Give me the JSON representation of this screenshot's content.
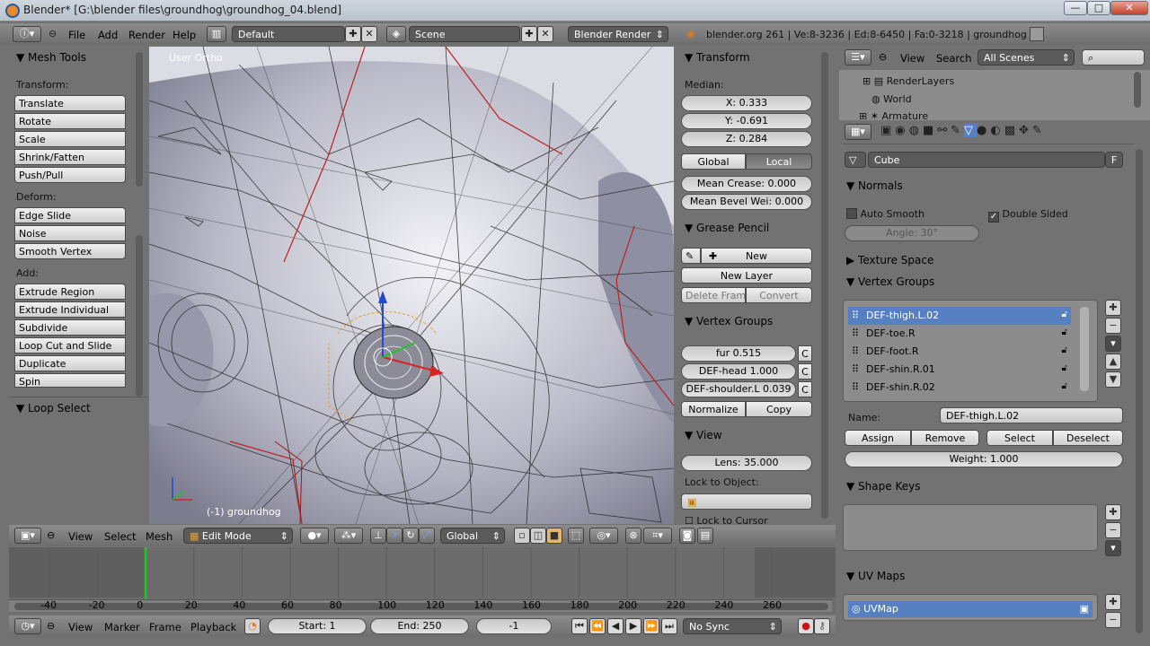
{
  "window": {
    "title": "Blender* [G:\\blender files\\groundhog\\groundhog_04.blend]",
    "minimize": "—",
    "maximize": "□",
    "close": "✕"
  },
  "info_header": {
    "menus": [
      "File",
      "Add",
      "Render",
      "Help"
    ],
    "layout": "Default",
    "scene": "Scene",
    "engine": "Blender Render",
    "stats": "blender.org 261 | Ve:8-3236 | Ed:8-6450 | Fa:0-3218 | groundhog"
  },
  "tool_shelf": {
    "title": "Mesh Tools",
    "sections": [
      {
        "label": "Transform:",
        "buttons": [
          "Translate",
          "Rotate",
          "Scale",
          "Shrink/Fatten",
          "Push/Pull"
        ]
      },
      {
        "label": "Deform:",
        "buttons": [
          "Edge Slide",
          "Noise",
          "Smooth Vertex"
        ]
      },
      {
        "label": "Add:",
        "buttons": [
          "Extrude Region",
          "Extrude Individual",
          "Subdivide",
          "Loop Cut and Slide",
          "Duplicate",
          "Spin"
        ]
      }
    ],
    "operator_panel": "Loop Select"
  },
  "viewport": {
    "view_label": "User Ortho",
    "object_label": "(-1) groundhog"
  },
  "properties_n": {
    "transform": {
      "title": "Transform",
      "median_label": "Median:",
      "x": "X: 0.333",
      "y": "Y: -0.691",
      "z": "Z: 0.284",
      "global": "Global",
      "local": "Local",
      "mean_crease": "Mean Crease: 0.000",
      "mean_bevel": "Mean Bevel Wei: 0.000"
    },
    "grease_pencil": {
      "title": "Grease Pencil",
      "new": "New",
      "new_layer": "New Layer",
      "delete_frame": "Delete Frame",
      "convert": "Convert"
    },
    "vertex_groups": {
      "title": "Vertex Groups",
      "rows": [
        "fur 0.515",
        "DEF-head 1.000",
        "DEF-shoulder.L 0.039"
      ],
      "normalize": "Normalize",
      "copy": "Copy"
    },
    "view": {
      "title": "View",
      "lens": "Lens: 35.000",
      "lock_to_object": "Lock to Object:",
      "lock_to_cursor": "Lock to Cursor"
    },
    "row_suffix": "C"
  },
  "viewport_header": {
    "menus": [
      "View",
      "Select",
      "Mesh"
    ],
    "mode": "Edit Mode",
    "orientation": "Global"
  },
  "timeline": {
    "ticks": [
      "-40",
      "-20",
      "0",
      "20",
      "40",
      "60",
      "80",
      "100",
      "120",
      "140",
      "160",
      "180",
      "200",
      "220",
      "240",
      "260"
    ],
    "current_frame_value": 0,
    "menus": [
      "View",
      "Marker",
      "Frame",
      "Playback"
    ],
    "start": "Start: 1",
    "end": "End: 250",
    "current": "-1",
    "sync": "No Sync"
  },
  "outliner": {
    "menus": [
      "View",
      "Search"
    ],
    "filter": "All Scenes",
    "items": [
      "RenderLayers",
      "World",
      "Armature"
    ]
  },
  "properties": {
    "object_name": "Cube",
    "fake_user": "F",
    "normals": {
      "title": "Normals",
      "auto_smooth": "Auto Smooth",
      "auto_smooth_checked": false,
      "double_sided": "Double Sided",
      "double_sided_checked": true,
      "angle": "Angle: 30°"
    },
    "texture_space": "Texture Space",
    "vertex_groups": {
      "title": "Vertex Groups",
      "items": [
        "DEF-thigh.L.02",
        "DEF-toe.R",
        "DEF-foot.R",
        "DEF-shin.R.01",
        "DEF-shin.R.02"
      ],
      "selected_index": 0,
      "name_label": "Name:",
      "name_value": "DEF-thigh.L.02",
      "assign": "Assign",
      "remove": "Remove",
      "select": "Select",
      "deselect": "Deselect",
      "weight": "Weight: 1.000"
    },
    "shape_keys": {
      "title": "Shape Keys"
    },
    "uv_maps": {
      "title": "UV Maps",
      "items": [
        "UVMap"
      ]
    }
  },
  "colors": {
    "selection": "#5680c2",
    "panel": "#727272",
    "viewport_bg": "#c9c9d0",
    "frame_line": "#22c322"
  }
}
